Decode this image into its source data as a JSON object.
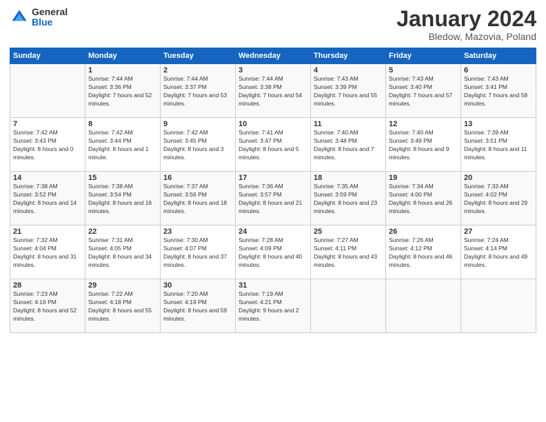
{
  "logo": {
    "general": "General",
    "blue": "Blue"
  },
  "title": "January 2024",
  "subtitle": "Bledow, Mazovia, Poland",
  "days_of_week": [
    "Sunday",
    "Monday",
    "Tuesday",
    "Wednesday",
    "Thursday",
    "Friday",
    "Saturday"
  ],
  "weeks": [
    [
      {
        "day": "",
        "sunrise": "",
        "sunset": "",
        "daylight": ""
      },
      {
        "day": "1",
        "sunrise": "Sunrise: 7:44 AM",
        "sunset": "Sunset: 3:36 PM",
        "daylight": "Daylight: 7 hours and 52 minutes."
      },
      {
        "day": "2",
        "sunrise": "Sunrise: 7:44 AM",
        "sunset": "Sunset: 3:37 PM",
        "daylight": "Daylight: 7 hours and 53 minutes."
      },
      {
        "day": "3",
        "sunrise": "Sunrise: 7:44 AM",
        "sunset": "Sunset: 3:38 PM",
        "daylight": "Daylight: 7 hours and 54 minutes."
      },
      {
        "day": "4",
        "sunrise": "Sunrise: 7:43 AM",
        "sunset": "Sunset: 3:39 PM",
        "daylight": "Daylight: 7 hours and 55 minutes."
      },
      {
        "day": "5",
        "sunrise": "Sunrise: 7:43 AM",
        "sunset": "Sunset: 3:40 PM",
        "daylight": "Daylight: 7 hours and 57 minutes."
      },
      {
        "day": "6",
        "sunrise": "Sunrise: 7:43 AM",
        "sunset": "Sunset: 3:41 PM",
        "daylight": "Daylight: 7 hours and 58 minutes."
      }
    ],
    [
      {
        "day": "7",
        "sunrise": "Sunrise: 7:42 AM",
        "sunset": "Sunset: 3:43 PM",
        "daylight": "Daylight: 8 hours and 0 minutes."
      },
      {
        "day": "8",
        "sunrise": "Sunrise: 7:42 AM",
        "sunset": "Sunset: 3:44 PM",
        "daylight": "Daylight: 8 hours and 1 minute."
      },
      {
        "day": "9",
        "sunrise": "Sunrise: 7:42 AM",
        "sunset": "Sunset: 3:45 PM",
        "daylight": "Daylight: 8 hours and 3 minutes."
      },
      {
        "day": "10",
        "sunrise": "Sunrise: 7:41 AM",
        "sunset": "Sunset: 3:47 PM",
        "daylight": "Daylight: 8 hours and 5 minutes."
      },
      {
        "day": "11",
        "sunrise": "Sunrise: 7:40 AM",
        "sunset": "Sunset: 3:48 PM",
        "daylight": "Daylight: 8 hours and 7 minutes."
      },
      {
        "day": "12",
        "sunrise": "Sunrise: 7:40 AM",
        "sunset": "Sunset: 3:49 PM",
        "daylight": "Daylight: 8 hours and 9 minutes."
      },
      {
        "day": "13",
        "sunrise": "Sunrise: 7:39 AM",
        "sunset": "Sunset: 3:51 PM",
        "daylight": "Daylight: 8 hours and 11 minutes."
      }
    ],
    [
      {
        "day": "14",
        "sunrise": "Sunrise: 7:38 AM",
        "sunset": "Sunset: 3:52 PM",
        "daylight": "Daylight: 8 hours and 14 minutes."
      },
      {
        "day": "15",
        "sunrise": "Sunrise: 7:38 AM",
        "sunset": "Sunset: 3:54 PM",
        "daylight": "Daylight: 8 hours and 16 minutes."
      },
      {
        "day": "16",
        "sunrise": "Sunrise: 7:37 AM",
        "sunset": "Sunset: 3:56 PM",
        "daylight": "Daylight: 8 hours and 18 minutes."
      },
      {
        "day": "17",
        "sunrise": "Sunrise: 7:36 AM",
        "sunset": "Sunset: 3:57 PM",
        "daylight": "Daylight: 8 hours and 21 minutes."
      },
      {
        "day": "18",
        "sunrise": "Sunrise: 7:35 AM",
        "sunset": "Sunset: 3:59 PM",
        "daylight": "Daylight: 8 hours and 23 minutes."
      },
      {
        "day": "19",
        "sunrise": "Sunrise: 7:34 AM",
        "sunset": "Sunset: 4:00 PM",
        "daylight": "Daylight: 8 hours and 26 minutes."
      },
      {
        "day": "20",
        "sunrise": "Sunrise: 7:33 AM",
        "sunset": "Sunset: 4:02 PM",
        "daylight": "Daylight: 8 hours and 29 minutes."
      }
    ],
    [
      {
        "day": "21",
        "sunrise": "Sunrise: 7:32 AM",
        "sunset": "Sunset: 4:04 PM",
        "daylight": "Daylight: 8 hours and 31 minutes."
      },
      {
        "day": "22",
        "sunrise": "Sunrise: 7:31 AM",
        "sunset": "Sunset: 4:05 PM",
        "daylight": "Daylight: 8 hours and 34 minutes."
      },
      {
        "day": "23",
        "sunrise": "Sunrise: 7:30 AM",
        "sunset": "Sunset: 4:07 PM",
        "daylight": "Daylight: 8 hours and 37 minutes."
      },
      {
        "day": "24",
        "sunrise": "Sunrise: 7:28 AM",
        "sunset": "Sunset: 4:09 PM",
        "daylight": "Daylight: 8 hours and 40 minutes."
      },
      {
        "day": "25",
        "sunrise": "Sunrise: 7:27 AM",
        "sunset": "Sunset: 4:11 PM",
        "daylight": "Daylight: 8 hours and 43 minutes."
      },
      {
        "day": "26",
        "sunrise": "Sunrise: 7:26 AM",
        "sunset": "Sunset: 4:12 PM",
        "daylight": "Daylight: 8 hours and 46 minutes."
      },
      {
        "day": "27",
        "sunrise": "Sunrise: 7:24 AM",
        "sunset": "Sunset: 4:14 PM",
        "daylight": "Daylight: 8 hours and 49 minutes."
      }
    ],
    [
      {
        "day": "28",
        "sunrise": "Sunrise: 7:23 AM",
        "sunset": "Sunset: 4:16 PM",
        "daylight": "Daylight: 8 hours and 52 minutes."
      },
      {
        "day": "29",
        "sunrise": "Sunrise: 7:22 AM",
        "sunset": "Sunset: 4:18 PM",
        "daylight": "Daylight: 8 hours and 55 minutes."
      },
      {
        "day": "30",
        "sunrise": "Sunrise: 7:20 AM",
        "sunset": "Sunset: 4:19 PM",
        "daylight": "Daylight: 8 hours and 59 minutes."
      },
      {
        "day": "31",
        "sunrise": "Sunrise: 7:19 AM",
        "sunset": "Sunset: 4:21 PM",
        "daylight": "Daylight: 9 hours and 2 minutes."
      },
      {
        "day": "",
        "sunrise": "",
        "sunset": "",
        "daylight": ""
      },
      {
        "day": "",
        "sunrise": "",
        "sunset": "",
        "daylight": ""
      },
      {
        "day": "",
        "sunrise": "",
        "sunset": "",
        "daylight": ""
      }
    ]
  ]
}
